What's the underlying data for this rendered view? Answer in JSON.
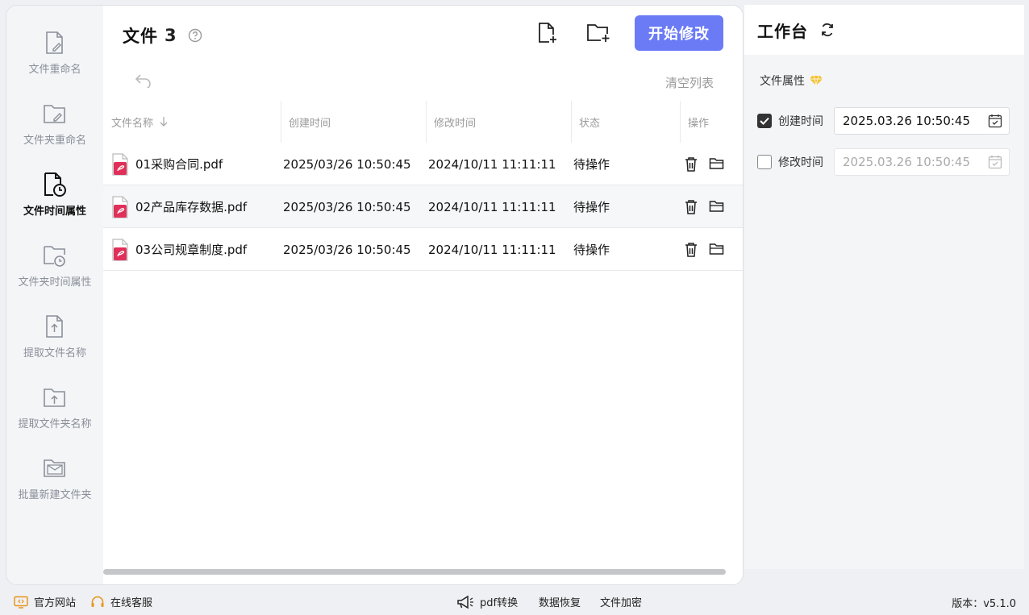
{
  "sidebar": {
    "items": [
      {
        "label": "文件重命名"
      },
      {
        "label": "文件夹重命名"
      },
      {
        "label": "文件时间属性"
      },
      {
        "label": "文件夹时间属性"
      },
      {
        "label": "提取文件名称"
      },
      {
        "label": "提取文件夹名称"
      },
      {
        "label": "批量新建文件夹"
      }
    ],
    "active_index": 2
  },
  "header": {
    "title": "文件",
    "count": "3",
    "start_label": "开始修改",
    "clear_label": "清空列表"
  },
  "table": {
    "columns": [
      "文件名称",
      "创建时间",
      "修改时间",
      "状态",
      "操作"
    ],
    "rows": [
      {
        "name": "01采购合同.pdf",
        "created": "2025/03/26 10:50:45",
        "modified": "2024/10/11 11:11:11",
        "status": "待操作"
      },
      {
        "name": "02产品库存数据.pdf",
        "created": "2025/03/26 10:50:45",
        "modified": "2024/10/11 11:11:11",
        "status": "待操作"
      },
      {
        "name": "03公司规章制度.pdf",
        "created": "2025/03/26 10:50:45",
        "modified": "2024/10/11 11:11:11",
        "status": "待操作"
      }
    ]
  },
  "workbench": {
    "title": "工作台",
    "section_label": "文件属性",
    "created": {
      "label": "创建时间",
      "value": "2025.03.26 10:50:45",
      "checked": true
    },
    "modified": {
      "label": "修改时间",
      "value": "2025.03.26 10:50:45",
      "checked": false
    }
  },
  "footer": {
    "website": "官方网站",
    "support": "在线客服",
    "pdf_convert": "pdf转换",
    "data_recovery": "数据恢复",
    "file_encrypt": "文件加密",
    "version": "版本：v5.1.0"
  },
  "colors": {
    "accent": "#6b7bf6",
    "pdf_red": "#e0305a",
    "gem": "#f2c233"
  }
}
